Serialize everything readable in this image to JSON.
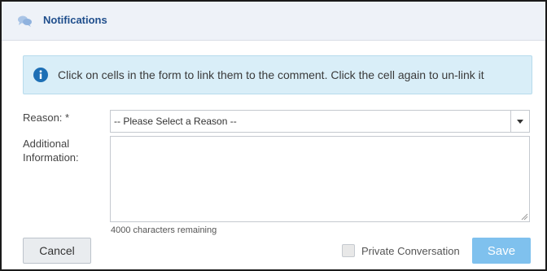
{
  "header": {
    "title": "Notifications",
    "icon": "chat-bubbles-icon"
  },
  "info": {
    "icon": "info-circle-icon",
    "text": "Click on cells in the form to link them to the comment. Click the cell again to un-link it"
  },
  "form": {
    "reason_label": "Reason: *",
    "reason_selected": "-- Please Select a Reason --",
    "additional_label_line1": "Additional",
    "additional_label_line2": "Information:",
    "additional_value": "",
    "chars_remaining": "4000 characters remaining"
  },
  "footer": {
    "cancel_label": "Cancel",
    "private_label": "Private Conversation",
    "private_checked": false,
    "save_label": "Save"
  },
  "colors": {
    "header_bg": "#eef2f8",
    "title": "#1f4e8c",
    "info_bg": "#d9eef8",
    "info_icon": "#1d6fb5",
    "save_bg": "#7fc1ee"
  }
}
